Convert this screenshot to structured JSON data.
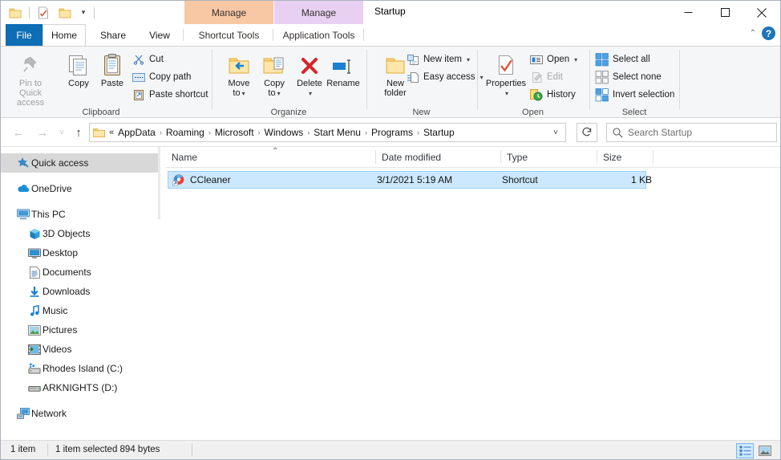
{
  "window": {
    "title": "Startup",
    "minimize_label": "—",
    "maximize_label": "☐",
    "close_label": "✕"
  },
  "quick_access_toolbar": {
    "items": [
      {
        "name": "folder-icon",
        "label": ""
      },
      {
        "name": "properties-icon",
        "label": ""
      },
      {
        "name": "new-folder-icon",
        "label": ""
      }
    ],
    "customize_caret": "▾"
  },
  "contextual_tabs": [
    {
      "group_label": "Manage",
      "tab_label": "Shortcut Tools",
      "color": "#f8c7a4"
    },
    {
      "group_label": "Manage",
      "tab_label": "Application Tools",
      "color": "#e8d0f2"
    }
  ],
  "ribbon": {
    "tabs": [
      {
        "label": "File"
      },
      {
        "label": "Home"
      },
      {
        "label": "Share"
      },
      {
        "label": "View"
      }
    ],
    "collapse_caret": "⌃",
    "help_label": "?",
    "groups": [
      {
        "name": "clipboard",
        "label": "Clipboard",
        "big_buttons": [
          {
            "label_line1": "Pin to Quick",
            "label_line2": "access",
            "icon": "pin-icon",
            "disabled": true
          },
          {
            "label_line1": "Copy",
            "label_line2": "",
            "icon": "copy-icon",
            "disabled": false
          },
          {
            "label_line1": "Paste",
            "label_line2": "",
            "icon": "paste-icon",
            "disabled": false
          }
        ],
        "small_buttons": [
          {
            "label": "Cut",
            "icon": "scissors-icon"
          },
          {
            "label": "Copy path",
            "icon": "copy-path-icon"
          },
          {
            "label": "Paste shortcut",
            "icon": "paste-shortcut-icon"
          }
        ]
      },
      {
        "name": "organize",
        "label": "Organize",
        "big_buttons": [
          {
            "label_line1": "Move",
            "label_line2": "to",
            "icon": "move-to-icon",
            "caret": "▾"
          },
          {
            "label_line1": "Copy",
            "label_line2": "to",
            "icon": "copy-to-icon",
            "caret": "▾"
          },
          {
            "label_line1": "Delete",
            "label_line2": "",
            "icon": "delete-icon",
            "caret": "▾"
          },
          {
            "label_line1": "Rename",
            "label_line2": "",
            "icon": "rename-icon",
            "caret": ""
          }
        ]
      },
      {
        "name": "new",
        "label": "New",
        "big_buttons": [
          {
            "label_line1": "New",
            "label_line2": "folder",
            "icon": "new-folder-icon"
          }
        ],
        "small_buttons": [
          {
            "label": "New item",
            "icon": "new-item-icon",
            "caret": "▾"
          },
          {
            "label": "Easy access",
            "icon": "easy-access-icon",
            "caret": "▾"
          }
        ]
      },
      {
        "name": "open",
        "label": "Open",
        "big_buttons": [
          {
            "label_line1": "Properties",
            "label_line2": "",
            "icon": "properties-icon",
            "caret": "▾"
          }
        ],
        "small_buttons": [
          {
            "label": "Open",
            "icon": "open-icon",
            "caret": "▾"
          },
          {
            "label": "Edit",
            "icon": "edit-icon",
            "disabled": true
          },
          {
            "label": "History",
            "icon": "history-icon"
          }
        ]
      },
      {
        "name": "select",
        "label": "Select",
        "small_buttons": [
          {
            "label": "Select all",
            "icon": "select-all-icon"
          },
          {
            "label": "Select none",
            "icon": "select-none-icon"
          },
          {
            "label": "Invert selection",
            "icon": "invert-selection-icon"
          }
        ]
      }
    ]
  },
  "navigation": {
    "back_label": "←",
    "forward_label": "→",
    "recent_caret": "˅",
    "up_label": "↑",
    "overflow": "«",
    "breadcrumbs": [
      "AppData",
      "Roaming",
      "Microsoft",
      "Windows",
      "Start Menu",
      "Programs",
      "Startup"
    ],
    "separator": "›",
    "dropdown_caret": "˅",
    "refresh_label": "↺"
  },
  "search": {
    "placeholder": "Search Startup",
    "icon": "search-icon"
  },
  "sidebar": {
    "items": [
      {
        "label": "Quick access",
        "icon": "star-pin-icon",
        "indent": 18,
        "selected": true
      },
      {
        "label": "OneDrive",
        "icon": "onedrive-cloud-icon",
        "indent": 18,
        "selected": false,
        "gap_before": true
      },
      {
        "label": "This PC",
        "icon": "this-pc-icon",
        "indent": 18,
        "selected": false,
        "gap_before": true
      },
      {
        "label": "3D Objects",
        "icon": "3d-objects-icon",
        "indent": 32,
        "selected": false
      },
      {
        "label": "Desktop",
        "icon": "desktop-icon",
        "indent": 32,
        "selected": false
      },
      {
        "label": "Documents",
        "icon": "documents-icon",
        "indent": 32,
        "selected": false
      },
      {
        "label": "Downloads",
        "icon": "downloads-icon",
        "indent": 32,
        "selected": false
      },
      {
        "label": "Music",
        "icon": "music-icon",
        "indent": 32,
        "selected": false
      },
      {
        "label": "Pictures",
        "icon": "pictures-icon",
        "indent": 32,
        "selected": false
      },
      {
        "label": "Videos",
        "icon": "videos-icon",
        "indent": 32,
        "selected": false
      },
      {
        "label": "Rhodes Island (C:)",
        "icon": "local-disk-icon",
        "indent": 32,
        "selected": false
      },
      {
        "label": "ARKNIGHTS (D:)",
        "icon": "removable-disk-icon",
        "indent": 32,
        "selected": false
      },
      {
        "label": "Network",
        "icon": "network-icon",
        "indent": 18,
        "selected": false,
        "gap_before": true
      }
    ]
  },
  "file_list": {
    "columns": [
      {
        "label": "Name",
        "sorted": "asc",
        "sort_glyph": "⌃"
      },
      {
        "label": "Date modified",
        "sorted": ""
      },
      {
        "label": "Type",
        "sorted": ""
      },
      {
        "label": "Size",
        "sorted": ""
      }
    ],
    "rows": [
      {
        "name": "CCleaner",
        "date_modified": "3/1/2021 5:19 AM",
        "type": "Shortcut",
        "size": "1 KB",
        "icon": "ccleaner-shortcut-icon",
        "selected": true
      }
    ]
  },
  "statusbar": {
    "item_count": "1 item",
    "selection_info": "1 item selected  894 bytes",
    "view_buttons": [
      {
        "name": "details-view-button",
        "active": true
      },
      {
        "name": "large-icons-view-button",
        "active": false
      }
    ]
  },
  "colors": {
    "accent": "#0d6db5",
    "selection": "#cce8ff",
    "selection_border": "#99d1ff",
    "ribbon_bg": "#f5f6f7",
    "shortcut_tools": "#f8c7a4",
    "application_tools": "#e8d0f2"
  }
}
